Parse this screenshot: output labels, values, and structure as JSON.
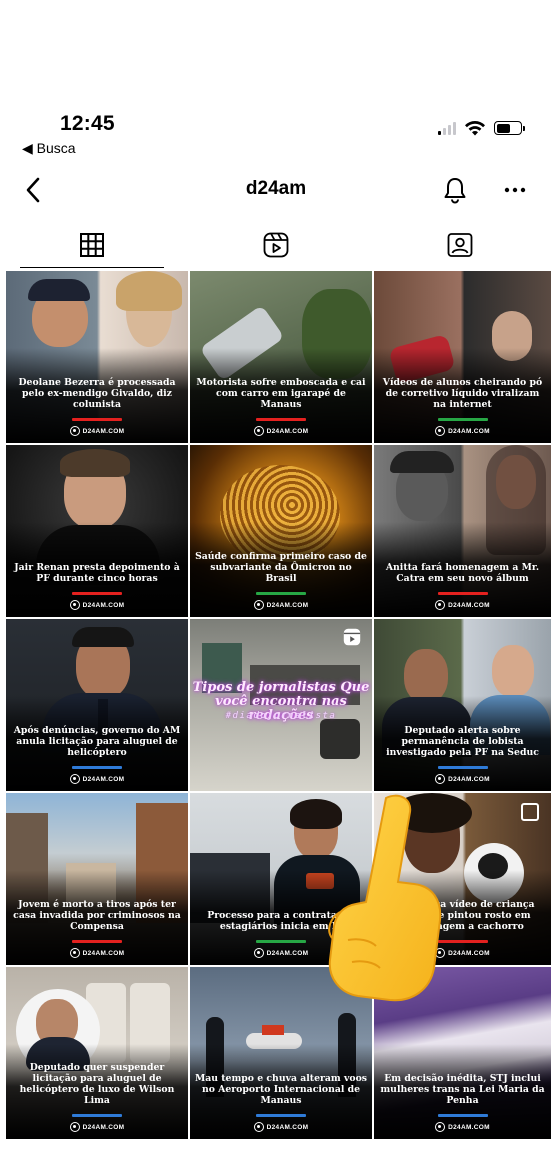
{
  "status_bar": {
    "time": "12:45",
    "back_app": "◀ Busca",
    "signal_bars_active": 1,
    "battery_level": 0.6
  },
  "nav": {
    "title": "d24am",
    "back_icon": "chevron-left-icon",
    "bell_icon": "bell-icon",
    "more_icon": "more-horizontal-icon"
  },
  "tabs": [
    {
      "name": "posts",
      "icon": "grid-icon",
      "active": true
    },
    {
      "name": "reels",
      "icon": "reels-icon",
      "active": false
    },
    {
      "name": "tagged",
      "icon": "tagged-user-icon",
      "active": false
    }
  ],
  "brand_label": "D24AM.COM",
  "posts": [
    {
      "caption": "Deolane Bezerra é processada pelo ex-mendigo Givaldo, diz colunista",
      "stripe_color": "#e4211f"
    },
    {
      "caption": "Motorista sofre emboscada e cai com carro em igarapé de Manaus",
      "stripe_color": "#e4211f"
    },
    {
      "caption": "Vídeos de alunos cheirando pó de corretivo líquido viralizam na internet",
      "stripe_color": "#27a745"
    },
    {
      "caption": "Jair Renan presta depoimento à PF durante cinco horas",
      "stripe_color": "#e4211f"
    },
    {
      "caption": "Saúde confirma primeiro caso de subvariante da Ômicron no Brasil",
      "stripe_color": "#27a745"
    },
    {
      "caption": "Anitta fará homenagem a Mr. Catra em seu novo álbum",
      "stripe_color": "#e4211f"
    },
    {
      "caption": "Após denúncias, governo do AM anula licitação para aluguel de helicóptero",
      "stripe_color": "#2f7bd8"
    },
    {
      "caption": "",
      "stripe_color": "",
      "reel": true,
      "overlay_title": "Tipos de jornalistas Que você encontra nas redações",
      "overlay_tag": "#diadojornalista"
    },
    {
      "caption": "Deputado alerta sobre permanência de lobista investigado pela PF na Seduc",
      "stripe_color": "#2f7bd8"
    },
    {
      "caption": "Jovem é morto a tiros após ter casa invadida por criminosos na Compensa",
      "stripe_color": "#e4211f"
    },
    {
      "caption": "Processo para a contratação estagiários inicia em M",
      "stripe_color": "#27a745"
    },
    {
      "caption": "vis publica vídeo de criança lleria que pintou rosto em homenagem a cachorro",
      "stripe_color": "#e4211f"
    },
    {
      "caption": "Deputado quer suspender licitação para aluguel de helicóptero de luxo de Wilson Lima",
      "stripe_color": "#2f7bd8"
    },
    {
      "caption": "Mau tempo e chuva alteram voos no Aeroporto Internacional de Manaus",
      "stripe_color": "#2f7bd8"
    },
    {
      "caption": "Em decisão inédita, STJ inclui mulheres trans na Lei Maria da Penha",
      "stripe_color": "#2f7bd8"
    }
  ],
  "overlay_icon": "pointing-hand-icon"
}
